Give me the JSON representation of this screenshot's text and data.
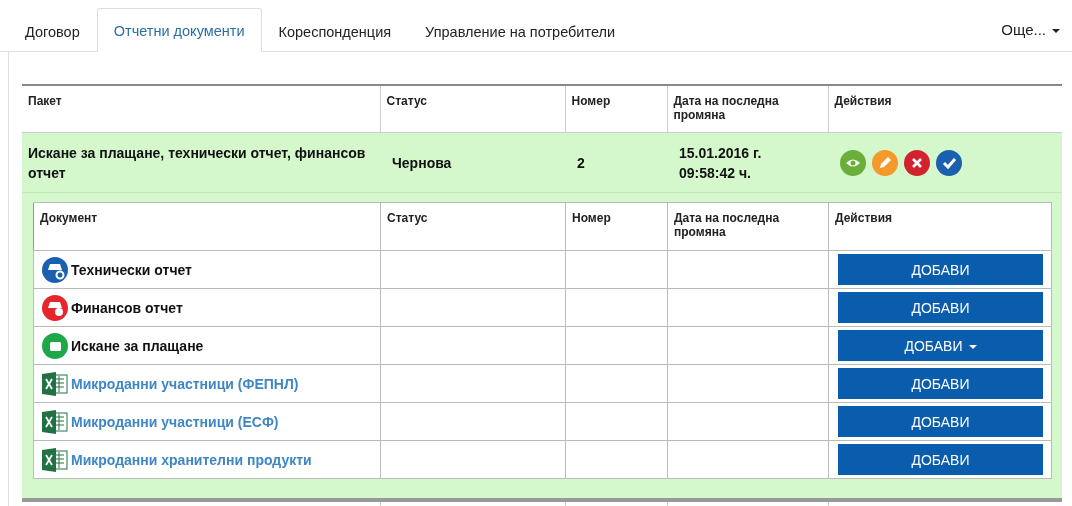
{
  "tabs": [
    {
      "label": "Договор",
      "selected": false
    },
    {
      "label": "Отчетни документи",
      "selected": true
    },
    {
      "label": "Кореспонденция",
      "selected": false
    },
    {
      "label": "Управление на потребители",
      "selected": false
    }
  ],
  "more_menu": {
    "label": "Още..."
  },
  "packages_table": {
    "columns": [
      "Пакет",
      "Статус",
      "Номер",
      "Дата на последна промяна",
      "Действия"
    ],
    "rows": [
      {
        "package": "Искане за плащане, технически отчет, финансов отчет",
        "status": "Чернова",
        "number": "2",
        "date": "15.01.2016 г. 09:58:42 ч.",
        "actions": [
          {
            "kind": "view"
          },
          {
            "kind": "edit"
          },
          {
            "kind": "delete"
          },
          {
            "kind": "confirm"
          }
        ],
        "documents": {
          "columns": [
            "Документ",
            "Статус",
            "Номер",
            "Дата на последна промяна",
            "Действия"
          ],
          "rows": [
            {
              "kind": "technical",
              "name": "Технически отчет",
              "button": "ДОБАВИ",
              "dropdown": false
            },
            {
              "kind": "financial",
              "name": "Финансов отчет",
              "button": "ДОБАВИ",
              "dropdown": false
            },
            {
              "kind": "payment",
              "name": "Искане за плащане",
              "button": "ДОБАВИ",
              "dropdown": true
            },
            {
              "kind": "spreadsheet",
              "name": "Микроданни участници (ФЕПНЛ)",
              "button": "ДОБАВИ",
              "dropdown": false
            },
            {
              "kind": "spreadsheet",
              "name": "Микроданни участници (ЕСФ)",
              "button": "ДОБАВИ",
              "dropdown": false
            },
            {
              "kind": "spreadsheet",
              "name": "Микроданни хранителни продукти",
              "button": "ДОБАВИ",
              "dropdown": false
            }
          ]
        }
      }
    ]
  }
}
